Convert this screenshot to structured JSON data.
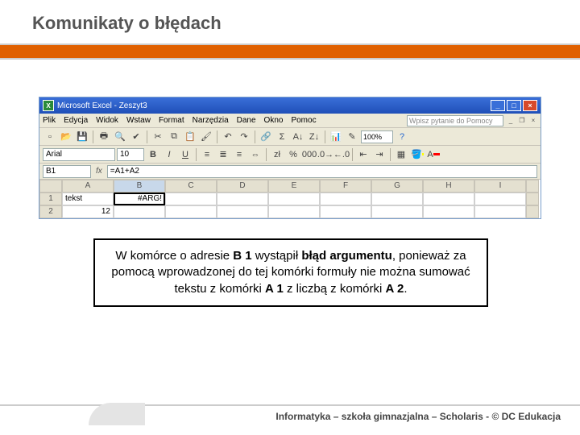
{
  "slide": {
    "title": "Komunikaty o błędach"
  },
  "window": {
    "app": "Microsoft Excel",
    "doc": "Zeszyt3"
  },
  "menu": {
    "file": "Plik",
    "edit": "Edycja",
    "view": "Widok",
    "insert": "Wstaw",
    "format": "Format",
    "tools": "Narzędzia",
    "data": "Dane",
    "window": "Okno",
    "help": "Pomoc",
    "help_placeholder": "Wpisz pytanie do Pomocy"
  },
  "toolbar": {
    "zoom": "100%"
  },
  "format": {
    "font_name": "Arial",
    "font_size": "10",
    "bold": "B",
    "italic": "I",
    "underline": "U",
    "currency_label": "zł",
    "percent": "%"
  },
  "formula": {
    "name_box": "B1",
    "fx": "fx",
    "formula": "=A1+A2"
  },
  "columns": [
    "A",
    "B",
    "C",
    "D",
    "E",
    "F",
    "G",
    "H",
    "I"
  ],
  "rows": {
    "r1": {
      "num": "1",
      "A": "tekst",
      "B": "#ARG!"
    },
    "r2": {
      "num": "2",
      "A": "12"
    }
  },
  "explain": {
    "pre": "W komórce o adresie ",
    "cell": "B 1",
    "mid": " wystąpił ",
    "err": "błąd argumentu",
    "post1": ", ponieważ za pomocą wprowadzonej do tej komórki formuły nie można sumować tekstu z komórki ",
    "a1": "A 1",
    "post2": " z liczbą z komórki ",
    "a2": "A 2",
    "post3": "."
  },
  "footer": {
    "text": "Informatyka – szkoła gimnazjalna – Scholaris - © DC Edukacja"
  }
}
